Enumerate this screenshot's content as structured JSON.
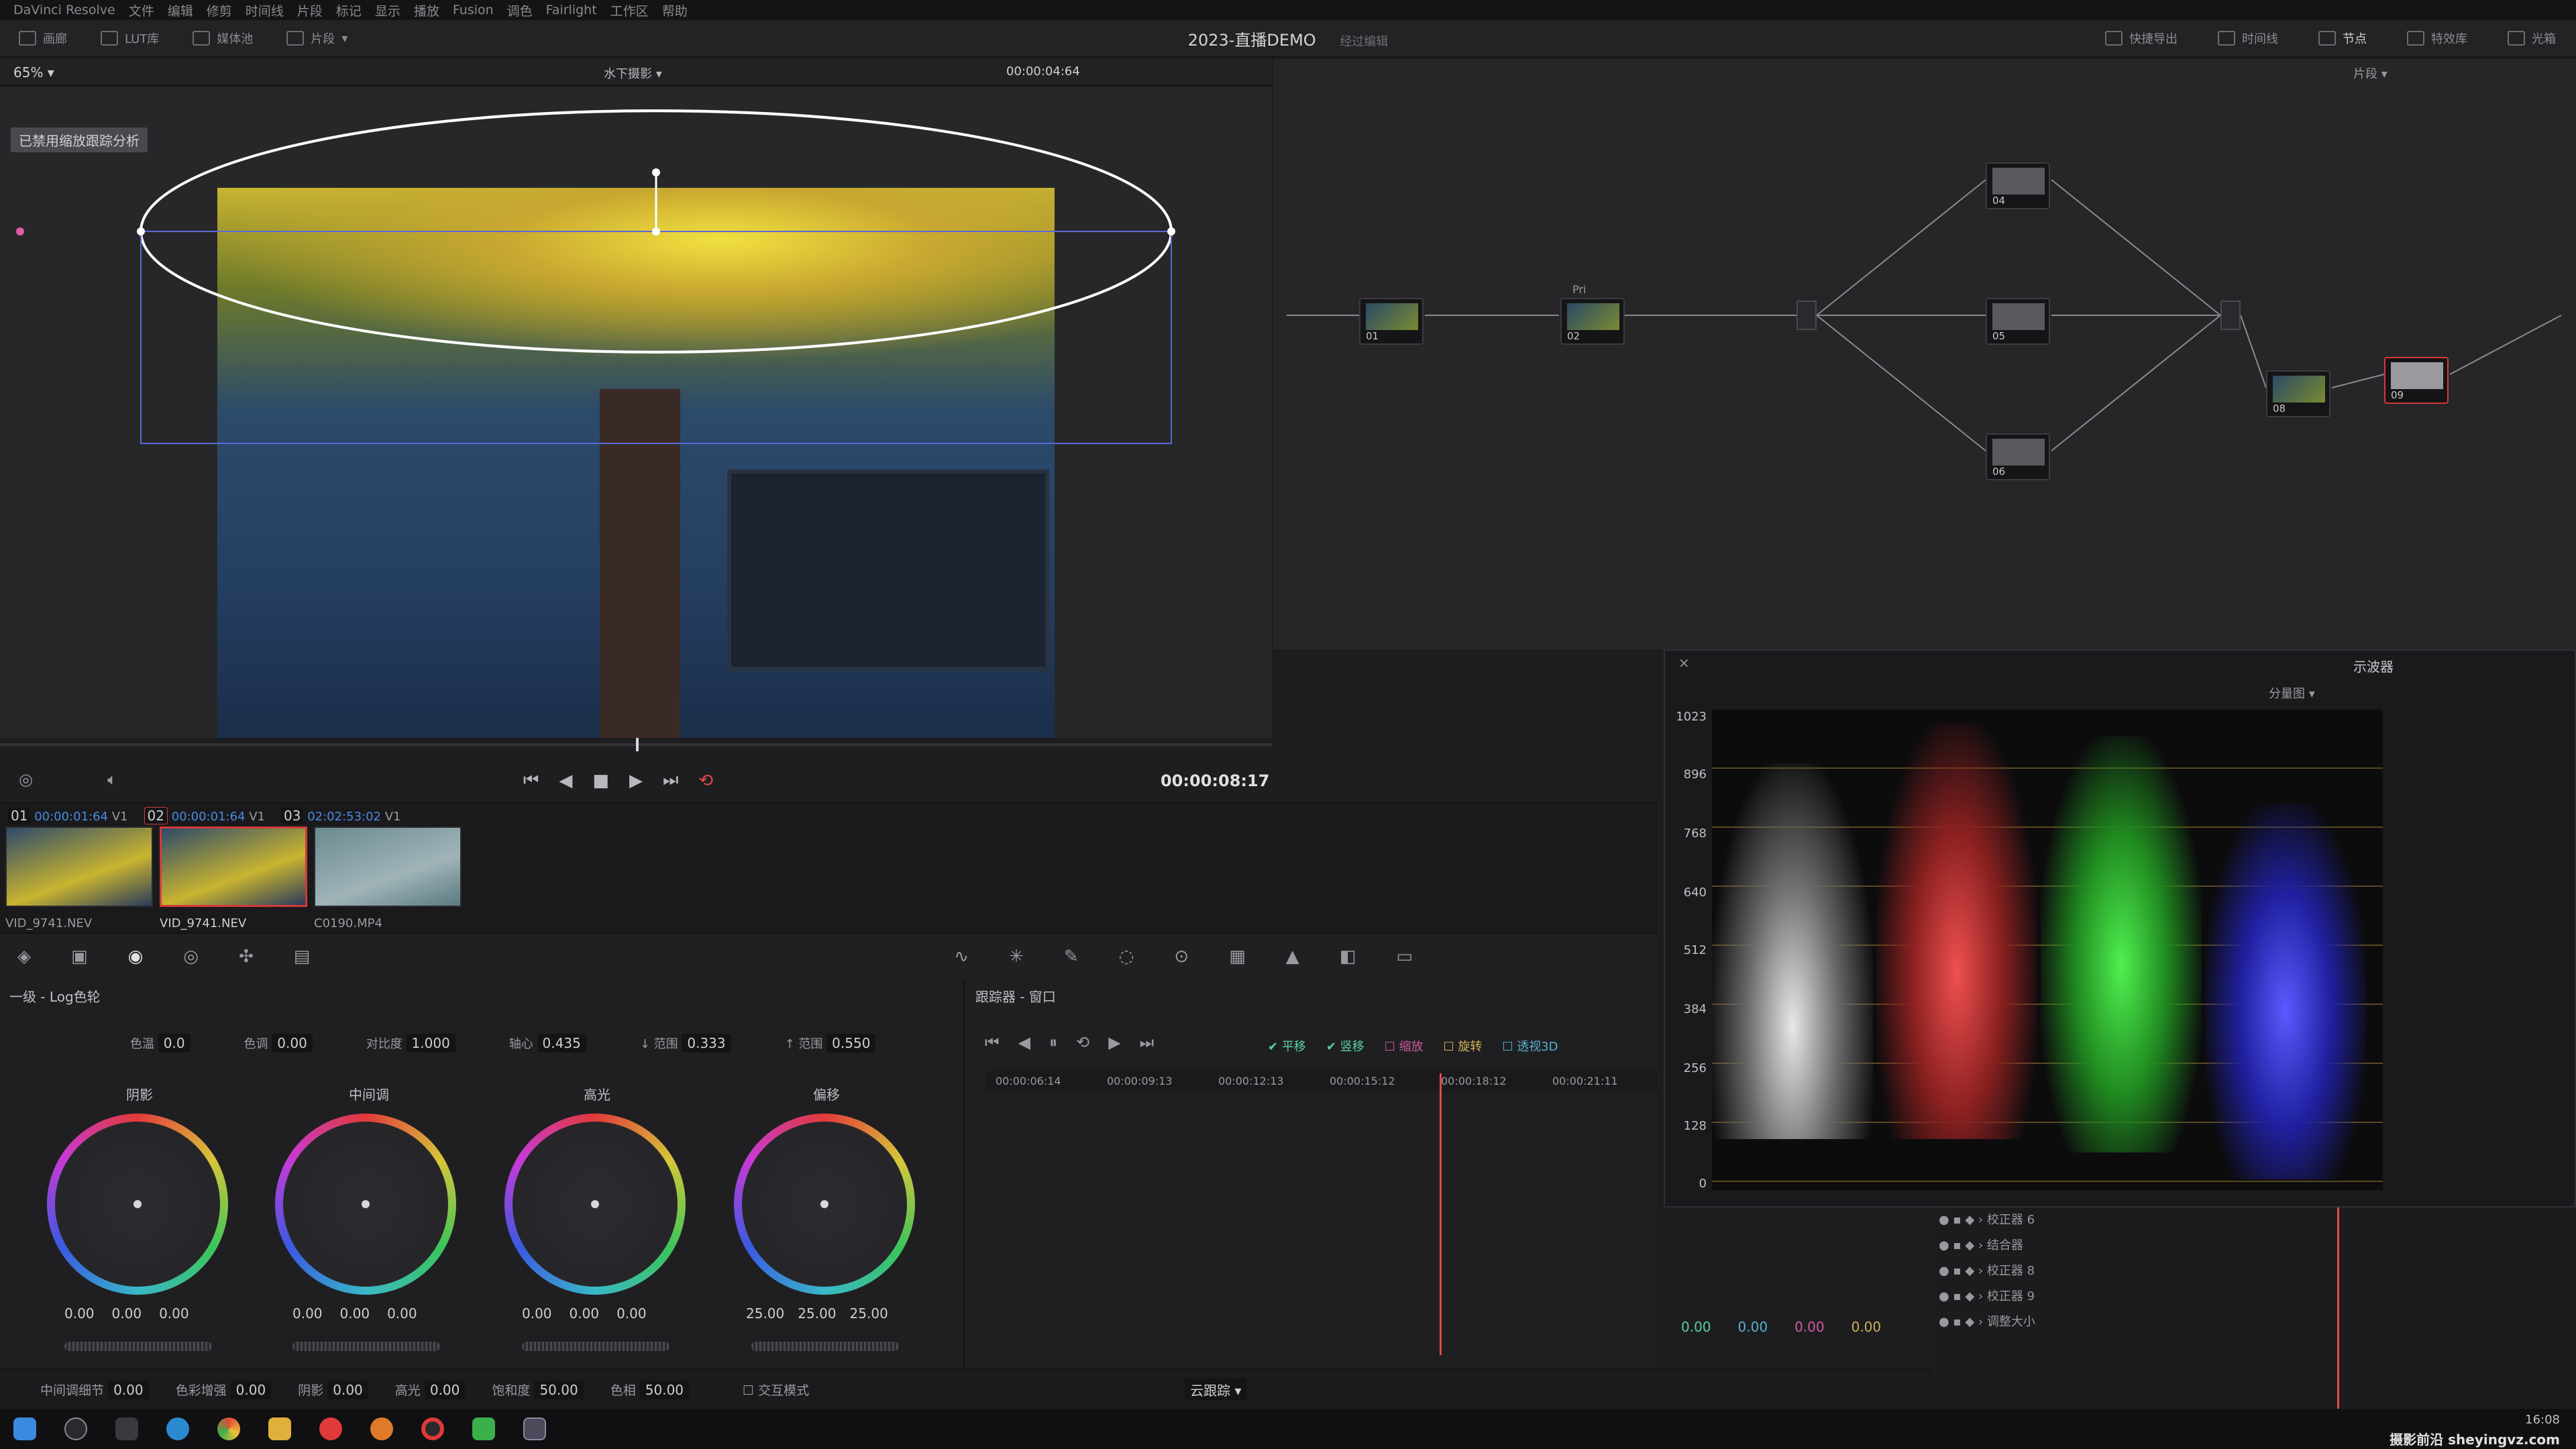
{
  "app": {
    "menu": [
      "DaVinci Resolve",
      "文件",
      "编辑",
      "修剪",
      "时间线",
      "片段",
      "标记",
      "显示",
      "播放",
      "Fusion",
      "调色",
      "Fairlight",
      "工作区",
      "帮助"
    ],
    "project_title": "2023-直播DEMO",
    "project_status": "经过编辑"
  },
  "topbar": {
    "left": [
      "画廊",
      "LUT库",
      "媒体池",
      "片段"
    ],
    "right": [
      "快捷导出",
      "时间线",
      "节点",
      "特效库",
      "光箱"
    ]
  },
  "viewer": {
    "zoom": "65%",
    "clip_name": "水下摄影",
    "timecode": "00:00:04:64",
    "overlay_notice": "已禁用缩放跟踪分析"
  },
  "transport": {
    "timecode": "00:00:08:17"
  },
  "clips": [
    {
      "num": "01",
      "tc": "00:00:01:64",
      "track": "V1",
      "name": "VID_9741.NEV"
    },
    {
      "num": "02",
      "tc": "00:00:01:64",
      "track": "V1",
      "name": "VID_9741.NEV"
    },
    {
      "num": "03",
      "tc": "02:02:53:02",
      "track": "V1",
      "name": "C0190.MP4"
    }
  ],
  "nodes": {
    "header_right": "片段",
    "items": [
      "01",
      "Pri",
      "02",
      "04",
      "05",
      "06",
      "08",
      "09"
    ]
  },
  "scope": {
    "title": "示波器",
    "mode": "分量图",
    "ticks": [
      "1023",
      "896",
      "768",
      "640",
      "512",
      "384",
      "256",
      "128",
      "0"
    ]
  },
  "wheels": {
    "title": "一级 - Log色轮",
    "params": [
      {
        "label": "色温",
        "value": "0.0"
      },
      {
        "label": "色调",
        "value": "0.00"
      },
      {
        "label": "对比度",
        "value": "1.000"
      },
      {
        "label": "轴心",
        "value": "0.435"
      },
      {
        "label": "↓ 范围",
        "value": "0.333"
      },
      {
        "label": "↑ 范围",
        "value": "0.550"
      }
    ],
    "items": [
      {
        "label": "阴影",
        "vals": [
          "0.00",
          "0.00",
          "0.00"
        ]
      },
      {
        "label": "中间调",
        "vals": [
          "0.00",
          "0.00",
          "0.00"
        ]
      },
      {
        "label": "高光",
        "vals": [
          "0.00",
          "0.00",
          "0.00"
        ]
      },
      {
        "label": "偏移",
        "vals": [
          "25.00",
          "25.00",
          "25.00"
        ]
      }
    ]
  },
  "status": [
    {
      "label": "中间调细节",
      "value": "0.00"
    },
    {
      "label": "色彩增强",
      "value": "0.00"
    },
    {
      "label": "阴影",
      "value": "0.00"
    },
    {
      "label": "高光",
      "value": "0.00"
    },
    {
      "label": "饱和度",
      "value": "50.00"
    },
    {
      "label": "色相",
      "value": "50.00"
    }
  ],
  "tracker": {
    "title": "跟踪器 - 窗口",
    "checks": [
      "平移",
      "竖移",
      "缩放",
      "旋转",
      "透视3D"
    ],
    "ruler": [
      "00:00:06:14",
      "00:00:09:13",
      "00:00:12:13",
      "00:00:15:12",
      "00:00:18:12",
      "00:00:21:11"
    ],
    "values": [
      "0.00",
      "0.00",
      "0.00",
      "0.00"
    ],
    "interactive": "交互模式",
    "cloud": "云跟踪"
  },
  "layers": [
    "校正器 6",
    "结合器",
    "校正器 8",
    "校正器 9",
    "调整大小"
  ],
  "taskbar": {
    "time": "16:08"
  },
  "watermark": "摄影前沿 sheyingvz.com"
}
